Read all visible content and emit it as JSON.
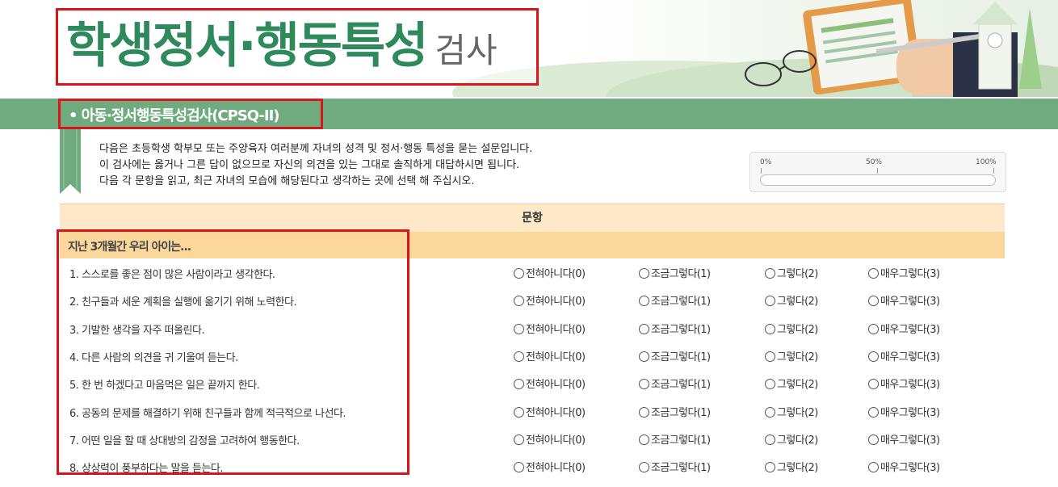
{
  "header": {
    "title_main": "학생정서·행동특성",
    "title_sub": "검사"
  },
  "section": {
    "title": "• 아동·정서행동특성검사(CPSQ-II)"
  },
  "intro": {
    "lines": [
      "다음은 초등학생 학부모 또는 주양육자 여러분께 자녀의 성격 및 정서·행동 특성을 묻는 설문입니다.",
      "이 검사에는 옳거나 그른 답이 없으므로 자신의 의견을 있는 그대로 솔직하게 대답하시면 됩니다.",
      "다음 각 문항을 읽고,  최근 자녀의 모습에 해당된다고 생각하는 곳에 선택 해 주십시오."
    ]
  },
  "progress": {
    "label_0": "0%",
    "label_50": "50%",
    "label_100": "100%",
    "value": 0
  },
  "table": {
    "header": "문항",
    "group_label": "지난 3개월간 우리 아이는...",
    "options": [
      "전혀아니다(0)",
      "조금그렇다(1)",
      "그렇다(2)",
      "매우그렇다(3)"
    ],
    "questions": [
      "1. 스스로를 좋은 점이 많은 사람이라고 생각한다.",
      "2. 친구들과 세운 계획을 실행에 옮기기 위해 노력한다.",
      "3. 기발한 생각을 자주 떠올린다.",
      "4. 다른 사람의 의견을 귀 기울여 듣는다.",
      "5. 한 번 하겠다고 마음먹은 일은 끝까지 한다.",
      "6. 공동의 문제를 해결하기 위해 친구들과 함께 적극적으로 나선다.",
      "7. 어떤 일을 할 때 상대방의 감정을 고려하여 행동한다.",
      "8. 상상력이 풍부하다는 말을 듣는다."
    ]
  },
  "colors": {
    "brand_green": "#2e8a5a",
    "bar_green": "#6fab7e",
    "table_header": "#fde9c9",
    "group_row": "#fcd79c",
    "highlight_red": "#d9141b"
  }
}
